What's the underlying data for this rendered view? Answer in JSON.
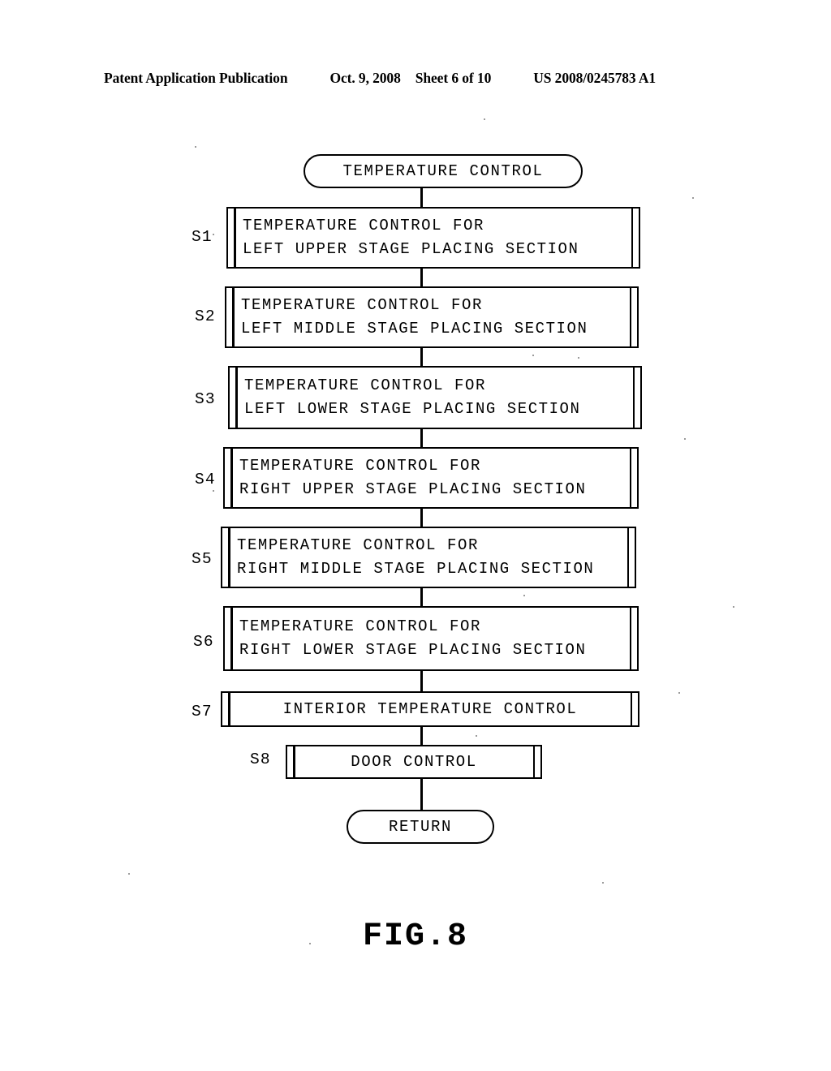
{
  "header": {
    "publication": "Patent Application Publication",
    "date": "Oct. 9, 2008",
    "sheet": "Sheet 6 of 10",
    "patent_number": "US 2008/0245783 A1"
  },
  "figure": {
    "caption": "FIG.8",
    "start_terminal": "TEMPERATURE CONTROL",
    "end_terminal": "RETURN"
  },
  "flowchart": {
    "steps": [
      {
        "id": "S1",
        "line1": "TEMPERATURE CONTROL FOR",
        "line2": "LEFT UPPER STAGE PLACING SECTION"
      },
      {
        "id": "S2",
        "line1": "TEMPERATURE CONTROL FOR",
        "line2": "LEFT MIDDLE STAGE PLACING SECTION"
      },
      {
        "id": "S3",
        "line1": "TEMPERATURE CONTROL FOR",
        "line2": "LEFT LOWER STAGE PLACING SECTION"
      },
      {
        "id": "S4",
        "line1": "TEMPERATURE CONTROL FOR",
        "line2": "RIGHT UPPER STAGE PLACING SECTION"
      },
      {
        "id": "S5",
        "line1": "TEMPERATURE CONTROL FOR",
        "line2": "RIGHT MIDDLE STAGE PLACING SECTION"
      },
      {
        "id": "S6",
        "line1": "TEMPERATURE CONTROL FOR",
        "line2": "RIGHT LOWER STAGE PLACING SECTION"
      },
      {
        "id": "S7",
        "line1": "INTERIOR TEMPERATURE CONTROL",
        "line2": ""
      },
      {
        "id": "S8",
        "line1": "DOOR CONTROL",
        "line2": ""
      }
    ]
  },
  "colors": {
    "ink": "#000000",
    "paper": "#ffffff"
  }
}
